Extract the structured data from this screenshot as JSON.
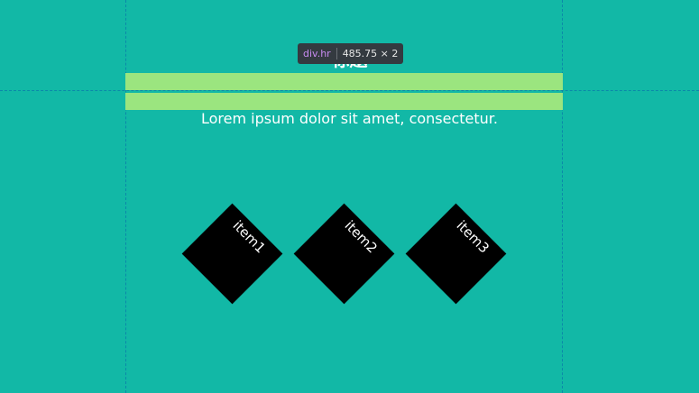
{
  "page": {
    "title": "标题",
    "subtitle": "Lorem ipsum dolor sit amet, consectetur."
  },
  "devtools": {
    "element_tag": "div.hr",
    "element_size": "485.75 × 2"
  },
  "items": [
    {
      "label": "item1"
    },
    {
      "label": "item2"
    },
    {
      "label": "item3"
    }
  ],
  "colors": {
    "background": "#12b8a6",
    "highlight": "#9be57f",
    "tooltip_bg": "#343a40",
    "tag_color": "#c88bf1",
    "diamond": "#000000"
  }
}
